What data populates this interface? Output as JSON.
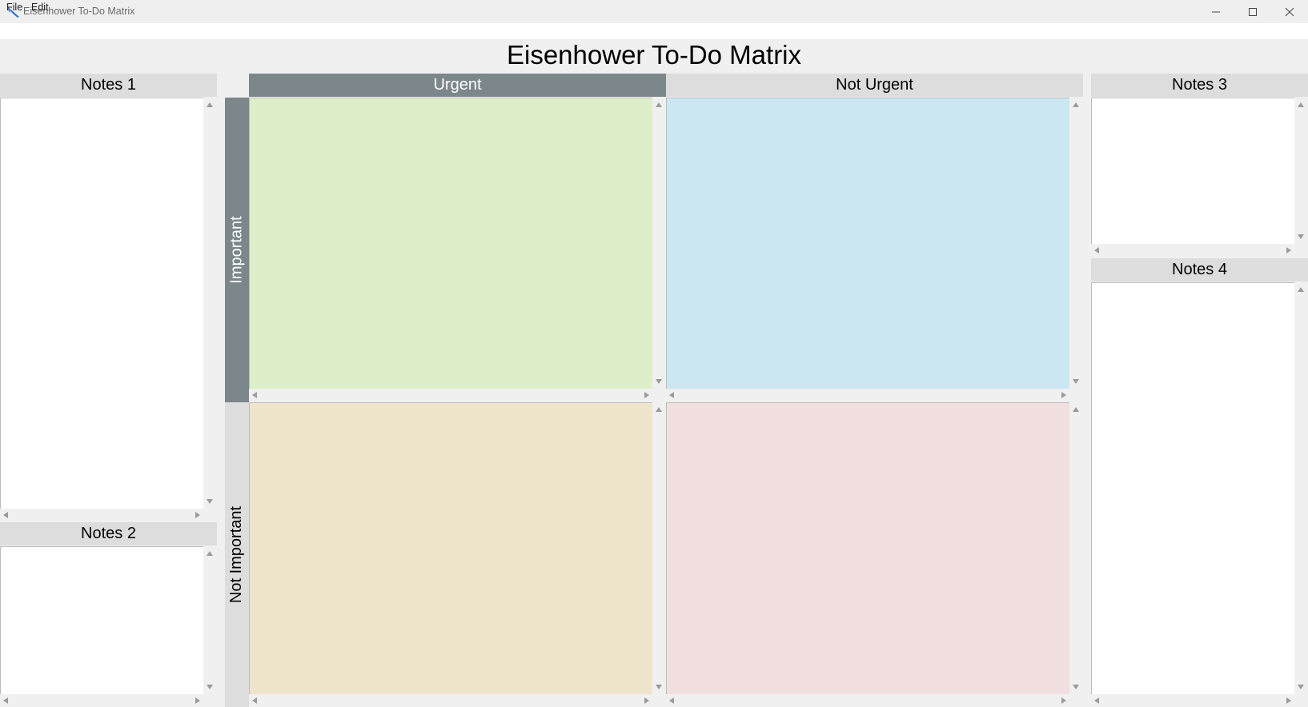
{
  "window": {
    "title": "Eisenhower To-Do Matrix"
  },
  "menu": {
    "file": "File",
    "edit": "Edit"
  },
  "heading": "Eisenhower To-Do Matrix",
  "columns": {
    "urgent": "Urgent",
    "not_urgent": "Not Urgent"
  },
  "rows": {
    "important": "Important",
    "not_important": "Not Important"
  },
  "notes": {
    "n1": {
      "title": "Notes 1",
      "content": ""
    },
    "n2": {
      "title": "Notes 2",
      "content": ""
    },
    "n3": {
      "title": "Notes 3",
      "content": ""
    },
    "n4": {
      "title": "Notes 4",
      "content": ""
    }
  },
  "quadrants": {
    "urgent_important": {
      "content": "",
      "color": "#ddefc8"
    },
    "not_urgent_important": {
      "content": "",
      "color": "#cbe7f1"
    },
    "urgent_not_important": {
      "content": "",
      "color": "#efe5cb"
    },
    "not_urgent_not_important": {
      "content": "",
      "color": "#f2dfdf"
    }
  },
  "colors": {
    "header_dark": "#7b878b",
    "header_light": "#dddddd"
  }
}
